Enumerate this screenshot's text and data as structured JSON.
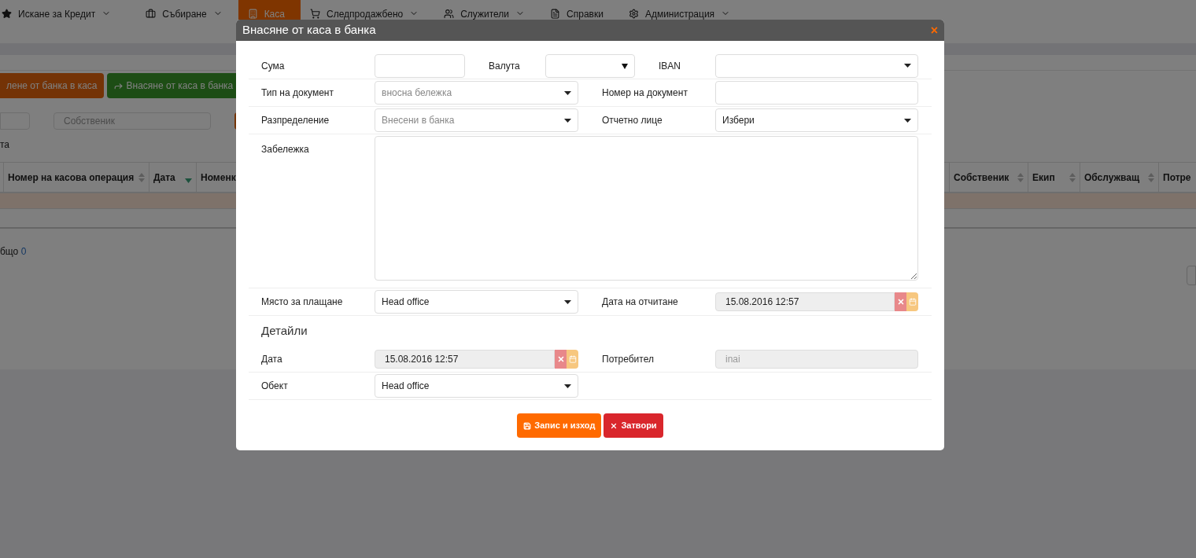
{
  "nav": {
    "items": [
      {
        "label": "Искане за Кредит",
        "selected": false,
        "dropdown": true
      },
      {
        "label": "Събиране",
        "selected": false,
        "dropdown": true
      },
      {
        "label": "Каса",
        "selected": true,
        "dropdown": false
      },
      {
        "label": "Следпродажбено",
        "selected": false,
        "dropdown": true
      },
      {
        "label": "Служители",
        "selected": false,
        "dropdown": true
      },
      {
        "label": "Справки",
        "selected": false,
        "dropdown": false
      },
      {
        "label": "Администрация",
        "selected": false,
        "dropdown": true
      }
    ]
  },
  "page": {
    "actions": [
      {
        "label": "лене от банка в каса",
        "kind": "orange"
      },
      {
        "label": "Внасяне от каса в банка",
        "kind": "green"
      }
    ],
    "filters": [
      {
        "placeholder": "Собственик"
      }
    ],
    "caption": "та",
    "table": {
      "left_columns": [
        {
          "label": "Номер на касова операция",
          "sorted": false
        },
        {
          "label": "Дата",
          "sorted": true
        },
        {
          "label": "Номенк"
        }
      ],
      "right_columns": [
        {
          "label": "Собственик",
          "sorted": false
        },
        {
          "label": "Екип",
          "sorted": false
        },
        {
          "label": "Обслужващ",
          "sorted": false
        },
        {
          "label": "Потре"
        }
      ]
    },
    "total_label": "бщо",
    "total_value": "0"
  },
  "modal": {
    "title": "Внасяне от каса в банка",
    "close": "×",
    "rows": [
      {
        "kind": "triple",
        "cells": [
          {
            "label": "Сума",
            "field": {
              "kind": "input"
            }
          },
          {
            "label": "Валута",
            "field": {
              "kind": "native_select"
            }
          },
          {
            "label": "IBAN",
            "field": {
              "kind": "select"
            }
          }
        ]
      },
      {
        "kind": "pair",
        "cells": [
          {
            "label": "Тип на документ",
            "field": {
              "kind": "select",
              "placeholder": "вносна бележка"
            }
          },
          {
            "label": "Номер на документ",
            "field": {
              "kind": "input"
            }
          }
        ]
      },
      {
        "kind": "pair",
        "cells": [
          {
            "label": "Разпределение",
            "field": {
              "kind": "select",
              "placeholder": "Внесени в банка"
            }
          },
          {
            "label": "Отчетно лице",
            "field": {
              "kind": "select",
              "value": "Избери"
            }
          }
        ]
      },
      {
        "kind": "wide",
        "cells": [
          {
            "label": "Забележка",
            "field": {
              "kind": "textarea"
            }
          }
        ]
      },
      {
        "kind": "pair",
        "cells": [
          {
            "label": "Място за плащане",
            "field": {
              "kind": "select",
              "value": "Head office"
            }
          },
          {
            "label": "Дата на отчитане",
            "field": {
              "kind": "date",
              "value": "15.08.2016 12:57"
            }
          }
        ]
      },
      {
        "kind": "heading",
        "text": "Детайли"
      },
      {
        "kind": "pair",
        "cells": [
          {
            "label": "Дата",
            "field": {
              "kind": "date",
              "value": "15.08.2016 12:57"
            }
          },
          {
            "label": "Потребител",
            "field": {
              "kind": "disabled",
              "value": "inai"
            }
          }
        ]
      },
      {
        "kind": "pair",
        "cells": [
          {
            "label": "Обект",
            "field": {
              "kind": "select",
              "value": "Head office"
            }
          }
        ]
      }
    ],
    "buttons": [
      {
        "label": "Запис и изход",
        "kind": "save"
      },
      {
        "label": "Затвори",
        "kind": "close"
      }
    ]
  }
}
